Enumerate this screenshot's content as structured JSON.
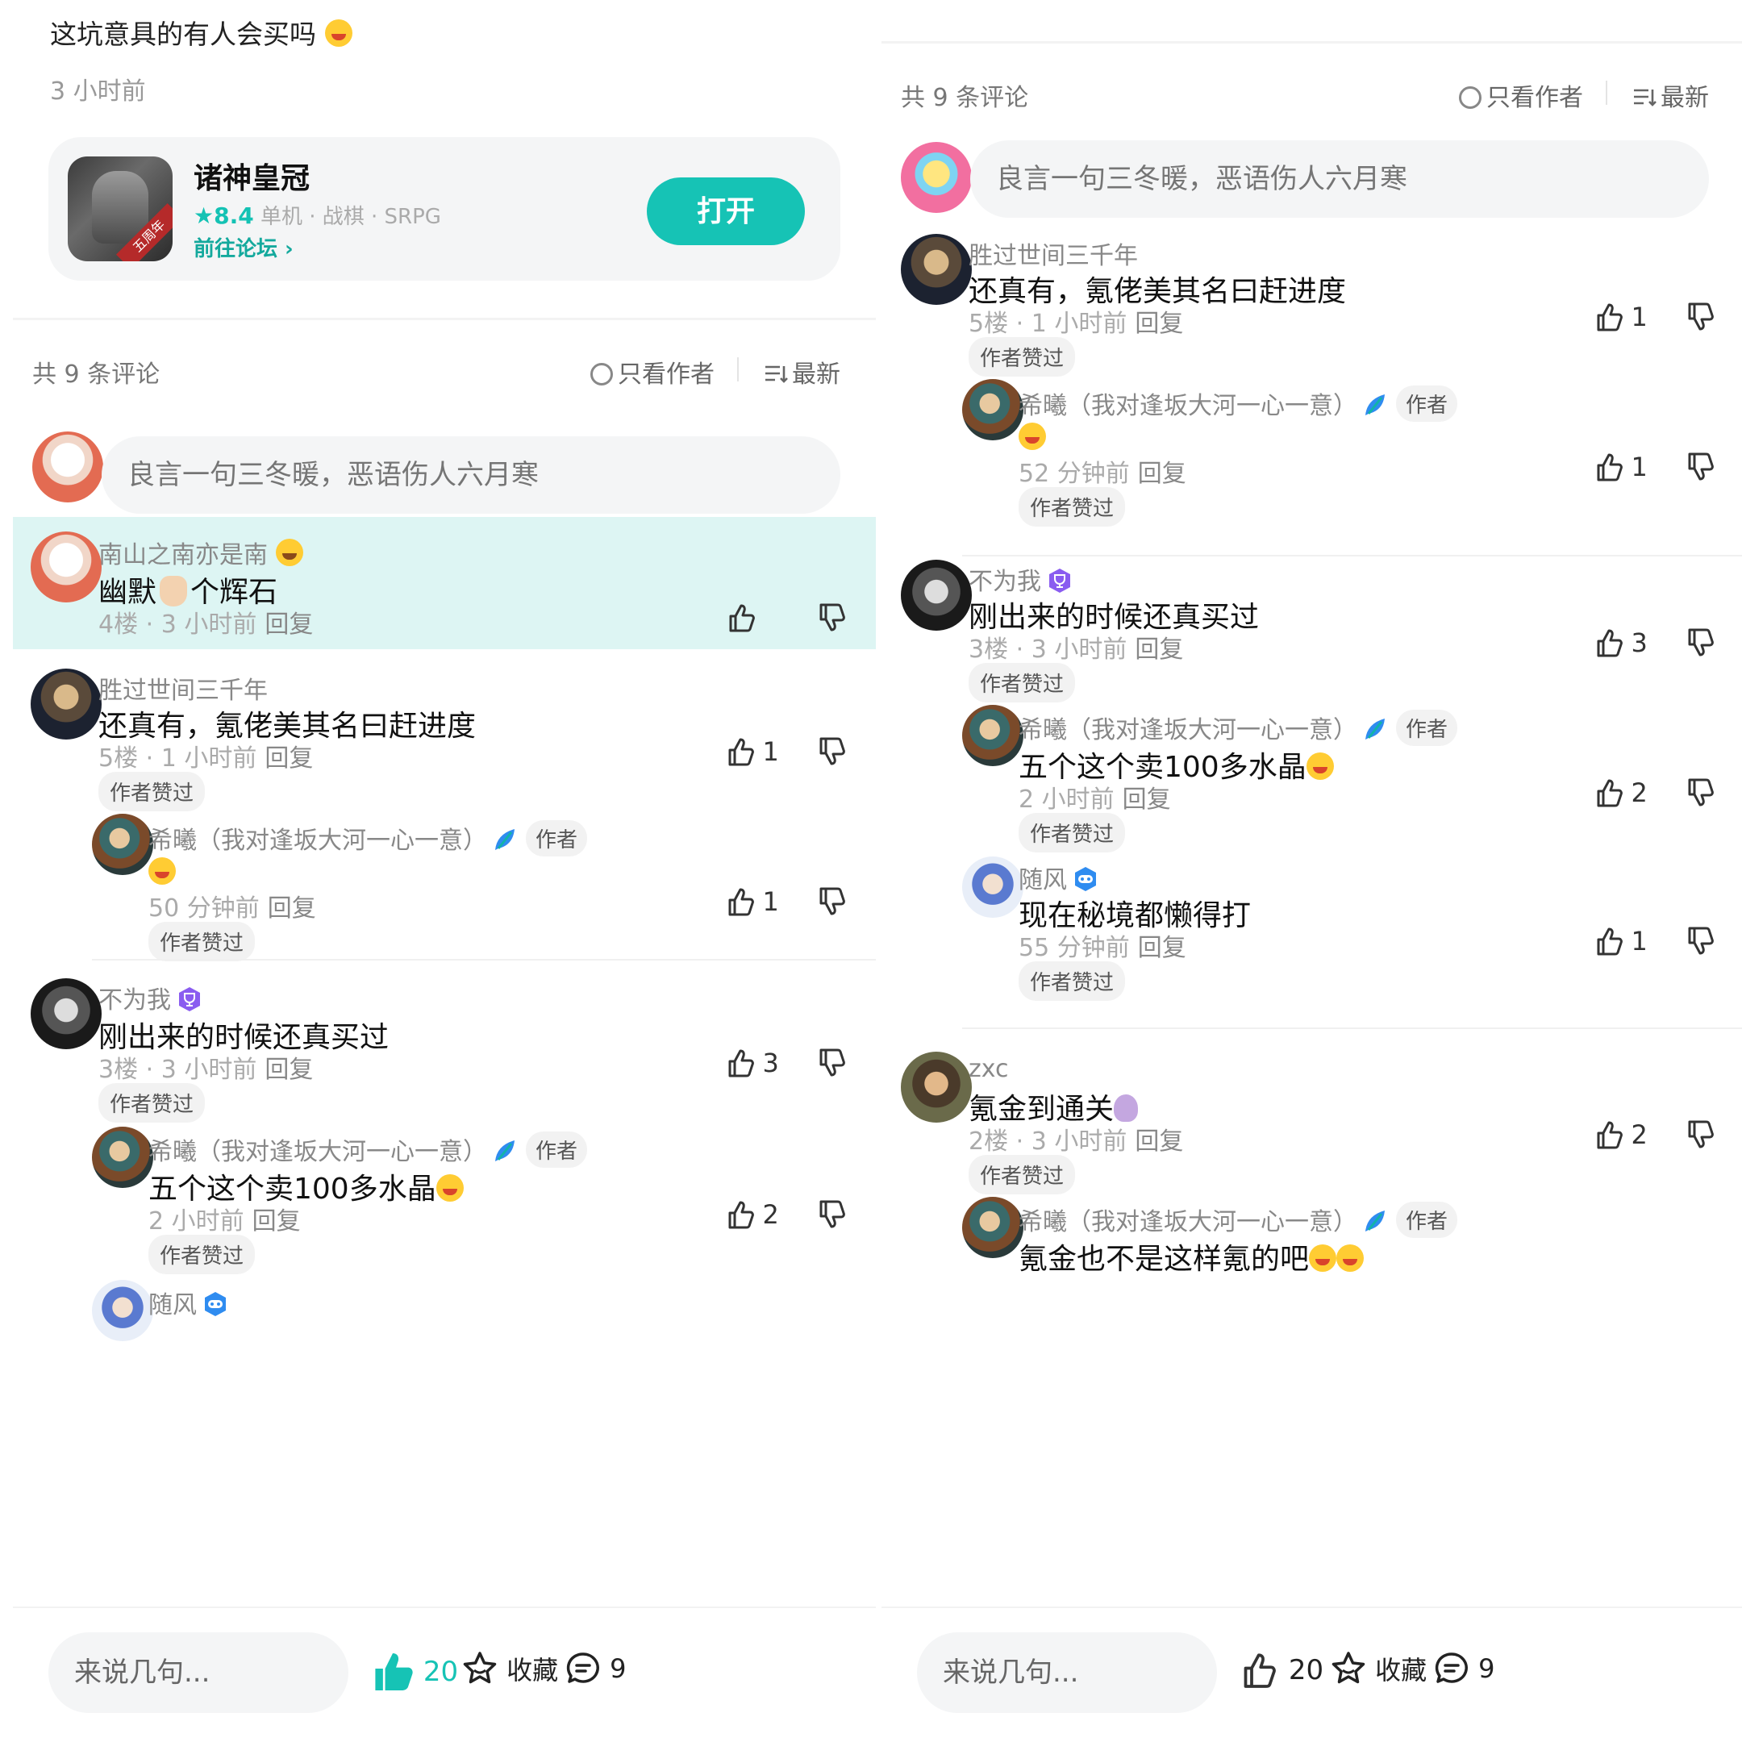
{
  "left": {
    "post": {
      "title": "这坑意具的有人会买吗",
      "time": "3 小时前"
    },
    "game": {
      "name": "诸神皇冠",
      "score": "★8.4",
      "meta": "单机 · 战棋 · SRPG",
      "link": "前往论坛 ›",
      "open": "打开",
      "ribbon": "五周年"
    },
    "comment_bar": {
      "count": "共 9 条评论",
      "only_author": "只看作者",
      "sort": "最新"
    },
    "reply_placeholder": "良言一句三冬暖，恶语伤人六月寒",
    "comments": [
      {
        "user": "南山之南亦是南",
        "text_a": "幽默",
        "text_b": "个辉石",
        "floor": "4楼",
        "time": "3 小时前",
        "reply": "回复",
        "likes": ""
      },
      {
        "user": "胜过世间三千年",
        "text": "还真有，氪佬美其名曰赶进度",
        "floor": "5楼",
        "time": "1 小时前",
        "reply": "回复",
        "likes": "1",
        "tag": "作者赞过",
        "sub": {
          "user": "希曦（我对逢坂大河一心一意）",
          "author": "作者",
          "time": "50 分钟前",
          "reply": "回复",
          "likes": "1",
          "tag": "作者赞过"
        }
      },
      {
        "user": "不为我",
        "text": "刚出来的时候还真买过",
        "floor": "3楼",
        "time": "3 小时前",
        "reply": "回复",
        "likes": "3",
        "tag": "作者赞过",
        "sub": {
          "user": "希曦（我对逢坂大河一心一意）",
          "author": "作者",
          "text": "五个这个卖100多水晶",
          "time": "2 小时前",
          "reply": "回复",
          "likes": "2",
          "tag": "作者赞过"
        },
        "sub2_user": "随风"
      }
    ],
    "bottom": {
      "say": "来说几句...",
      "likes": "20",
      "fav": "收藏",
      "comments": "9"
    }
  },
  "right": {
    "comment_bar": {
      "count": "共 9 条评论",
      "only_author": "只看作者",
      "sort": "最新"
    },
    "reply_placeholder": "良言一句三冬暖，恶语伤人六月寒",
    "comments": [
      {
        "user": "胜过世间三千年",
        "text": "还真有，氪佬美其名曰赶进度",
        "floor": "5楼",
        "time": "1 小时前",
        "reply": "回复",
        "likes": "1",
        "tag": "作者赞过",
        "sub": {
          "user": "希曦（我对逢坂大河一心一意）",
          "author": "作者",
          "time": "52 分钟前",
          "reply": "回复",
          "likes": "1",
          "tag": "作者赞过"
        }
      },
      {
        "user": "不为我",
        "text": "刚出来的时候还真买过",
        "floor": "3楼",
        "time": "3 小时前",
        "reply": "回复",
        "likes": "3",
        "tag": "作者赞过",
        "sub": {
          "user": "希曦（我对逢坂大河一心一意）",
          "author": "作者",
          "text": "五个这个卖100多水晶",
          "time": "2 小时前",
          "reply": "回复",
          "likes": "2",
          "tag": "作者赞过"
        },
        "sub2": {
          "user": "随风",
          "text": "现在秘境都懒得打",
          "time": "55 分钟前",
          "reply": "回复",
          "likes": "1",
          "tag": "作者赞过"
        }
      },
      {
        "user": "zxc",
        "text": "氪金到通关",
        "floor": "2楼",
        "time": "3 小时前",
        "reply": "回复",
        "likes": "2",
        "tag": "作者赞过",
        "sub": {
          "user": "希曦（我对逢坂大河一心一意）",
          "author": "作者",
          "text": "氪金也不是这样氪的吧"
        }
      }
    ],
    "bottom": {
      "say": "来说几句...",
      "likes": "20",
      "fav": "收藏",
      "comments": "9"
    }
  },
  "colors": {
    "accent": "#16c3b5",
    "highlight": "#ddf5f3",
    "badge_purple": "#8a5cf0",
    "badge_blue": "#2f8cf0"
  },
  "icons": [
    "thumb-up-icon",
    "thumb-down-icon",
    "star-icon",
    "comment-icon",
    "sort-icon",
    "circle-icon",
    "chevron-right-icon",
    "trophy-badge-icon",
    "gamepad-badge-icon",
    "author-leaf-icon"
  ]
}
